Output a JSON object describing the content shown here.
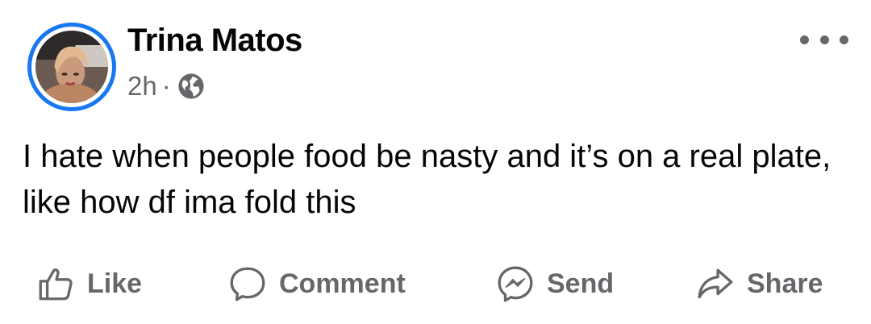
{
  "post": {
    "author": "Trina Matos",
    "time": "2h",
    "separator": "·",
    "privacy_icon": "globe-icon",
    "text": "I hate when people food be nasty and it’s on a real plate, like how df ima fold this"
  },
  "actions": {
    "like": {
      "label": "Like",
      "icon": "thumbs-up-icon"
    },
    "comment": {
      "label": "Comment",
      "icon": "comment-bubble-icon"
    },
    "send": {
      "label": "Send",
      "icon": "messenger-icon"
    },
    "share": {
      "label": "Share",
      "icon": "share-arrow-icon"
    }
  },
  "colors": {
    "accent": "#1877f2",
    "text": "#050505",
    "secondary": "#65676b"
  }
}
